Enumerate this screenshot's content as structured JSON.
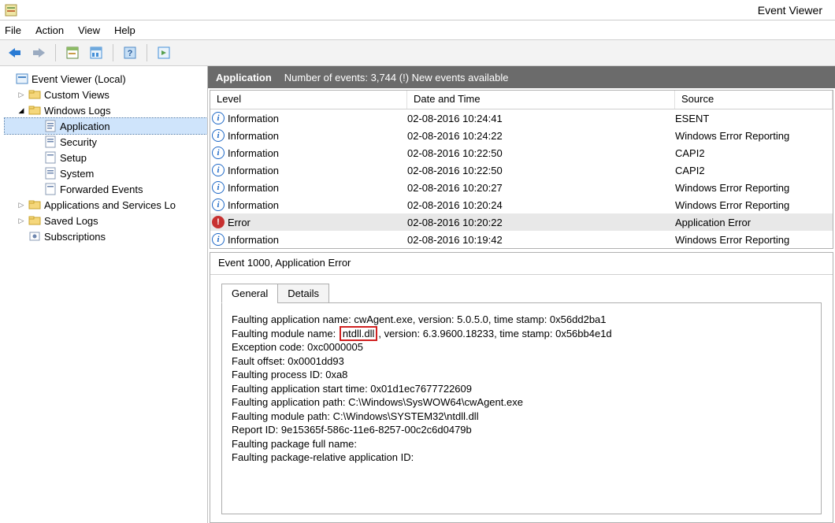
{
  "window": {
    "title": "Event Viewer"
  },
  "menubar": [
    "File",
    "Action",
    "View",
    "Help"
  ],
  "tree": {
    "root": "Event Viewer (Local)",
    "custom_views": "Custom Views",
    "windows_logs": "Windows Logs",
    "wl_children": [
      "Application",
      "Security",
      "Setup",
      "System",
      "Forwarded Events"
    ],
    "apps_services": "Applications and Services Lo",
    "saved_logs": "Saved Logs",
    "subscriptions": "Subscriptions"
  },
  "header": {
    "log_name": "Application",
    "summary": "Number of events: 3,744 (!) New events available"
  },
  "columns": {
    "level": "Level",
    "date": "Date and Time",
    "source": "Source"
  },
  "events": [
    {
      "level": "Information",
      "kind": "info",
      "date": "02-08-2016 10:24:41",
      "source": "ESENT"
    },
    {
      "level": "Information",
      "kind": "info",
      "date": "02-08-2016 10:24:22",
      "source": "Windows Error Reporting"
    },
    {
      "level": "Information",
      "kind": "info",
      "date": "02-08-2016 10:22:50",
      "source": "CAPI2"
    },
    {
      "level": "Information",
      "kind": "info",
      "date": "02-08-2016 10:22:50",
      "source": "CAPI2"
    },
    {
      "level": "Information",
      "kind": "info",
      "date": "02-08-2016 10:20:27",
      "source": "Windows Error Reporting"
    },
    {
      "level": "Information",
      "kind": "info",
      "date": "02-08-2016 10:20:24",
      "source": "Windows Error Reporting"
    },
    {
      "level": "Error",
      "kind": "error",
      "date": "02-08-2016 10:20:22",
      "source": "Application Error"
    },
    {
      "level": "Information",
      "kind": "info",
      "date": "02-08-2016 10:19:42",
      "source": "Windows Error Reporting"
    }
  ],
  "detail": {
    "title": "Event 1000, Application Error",
    "tabs": {
      "general": "General",
      "details": "Details"
    },
    "lines": {
      "l1a": "Faulting application name: cwAgent.exe, version: 5.0.5.0, time stamp: 0x56dd2ba1",
      "l2_pre": "Faulting module name:",
      "l2_hl": "ntdll.dll",
      "l2_post": ", version: 6.3.9600.18233, time stamp: 0x56bb4e1d",
      "l3": "Exception code: 0xc0000005",
      "l4": "Fault offset: 0x0001dd93",
      "l5": "Faulting process ID: 0xa8",
      "l6": "Faulting application start time: 0x01d1ec7677722609",
      "l7": "Faulting application path: C:\\Windows\\SysWOW64\\cwAgent.exe",
      "l8": "Faulting module path: C:\\Windows\\SYSTEM32\\ntdll.dll",
      "l9": "Report ID: 9e15365f-586c-11e6-8257-00c2c6d0479b",
      "l10": "Faulting package full name:",
      "l11": "Faulting package-relative application ID:"
    }
  }
}
